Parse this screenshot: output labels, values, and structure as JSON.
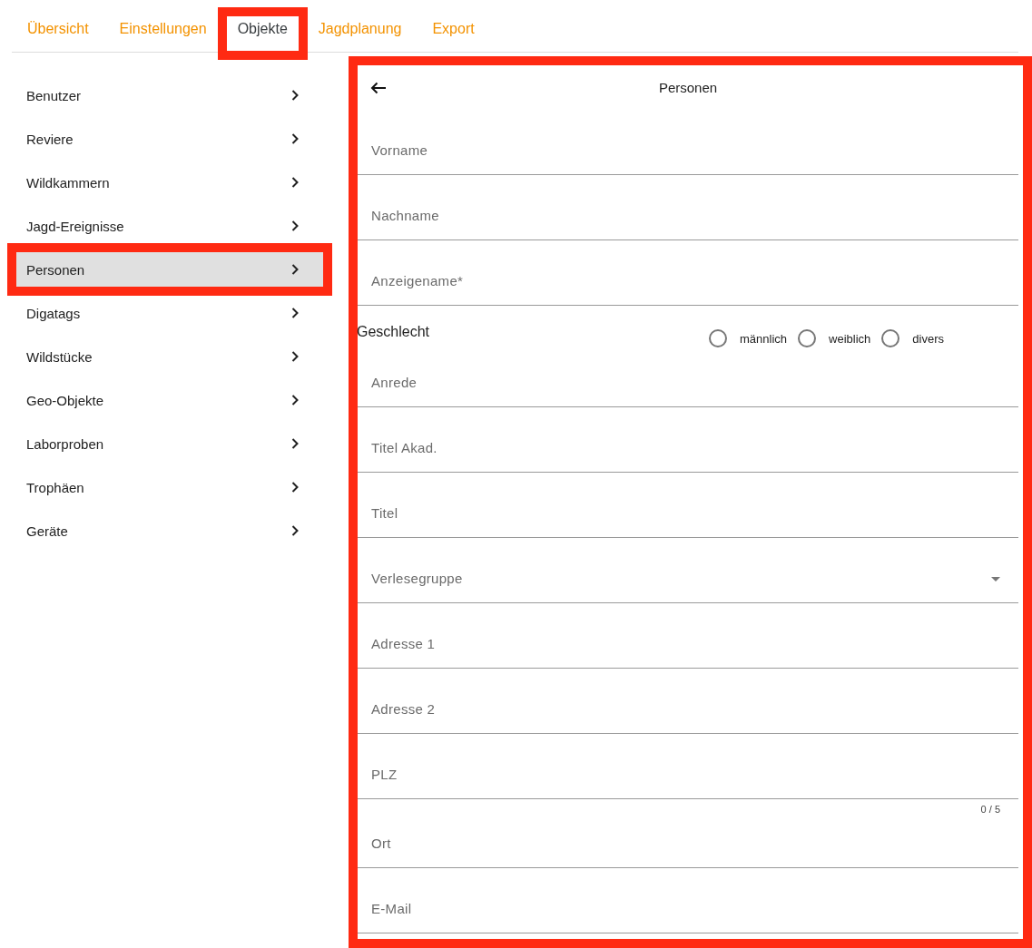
{
  "tabs": [
    {
      "label": "Übersicht",
      "selected": false,
      "highlighted": false
    },
    {
      "label": "Einstellungen",
      "selected": false,
      "highlighted": false
    },
    {
      "label": "Objekte",
      "selected": true,
      "highlighted": true
    },
    {
      "label": "Jagdplanung",
      "selected": false,
      "highlighted": false
    },
    {
      "label": "Export",
      "selected": false,
      "highlighted": false
    }
  ],
  "sidebar": {
    "items": [
      {
        "label": "Benutzer",
        "selected": false,
        "highlighted": false
      },
      {
        "label": "Reviere",
        "selected": false,
        "highlighted": false
      },
      {
        "label": "Wildkammern",
        "selected": false,
        "highlighted": false
      },
      {
        "label": "Jagd-Ereignisse",
        "selected": false,
        "highlighted": false
      },
      {
        "label": "Personen",
        "selected": true,
        "highlighted": true
      },
      {
        "label": "Digatags",
        "selected": false,
        "highlighted": false
      },
      {
        "label": "Wildstücke",
        "selected": false,
        "highlighted": false
      },
      {
        "label": "Geo-Objekte",
        "selected": false,
        "highlighted": false
      },
      {
        "label": "Laborproben",
        "selected": false,
        "highlighted": false
      },
      {
        "label": "Trophäen",
        "selected": false,
        "highlighted": false
      },
      {
        "label": "Geräte",
        "selected": false,
        "highlighted": false
      }
    ]
  },
  "form": {
    "title": "Personen",
    "highlighted": true,
    "fields": [
      {
        "kind": "text",
        "placeholder": "Vorname"
      },
      {
        "kind": "text",
        "placeholder": "Nachname"
      },
      {
        "kind": "text",
        "placeholder": "Anzeigename*"
      },
      {
        "kind": "radio",
        "label": "Geschlecht",
        "options": [
          {
            "label": "männlich",
            "selected": false
          },
          {
            "label": "weiblich",
            "selected": false
          },
          {
            "label": "divers",
            "selected": false
          }
        ]
      },
      {
        "kind": "text",
        "placeholder": "Anrede"
      },
      {
        "kind": "text",
        "placeholder": "Titel Akad."
      },
      {
        "kind": "text",
        "placeholder": "Titel"
      },
      {
        "kind": "select",
        "placeholder": "Verlesegruppe"
      },
      {
        "kind": "text",
        "placeholder": "Adresse 1"
      },
      {
        "kind": "text",
        "placeholder": "Adresse 2"
      },
      {
        "kind": "text",
        "placeholder": "PLZ",
        "counter": "0 / 5"
      },
      {
        "kind": "text",
        "placeholder": "Ort"
      },
      {
        "kind": "text",
        "placeholder": "E-Mail"
      }
    ]
  }
}
